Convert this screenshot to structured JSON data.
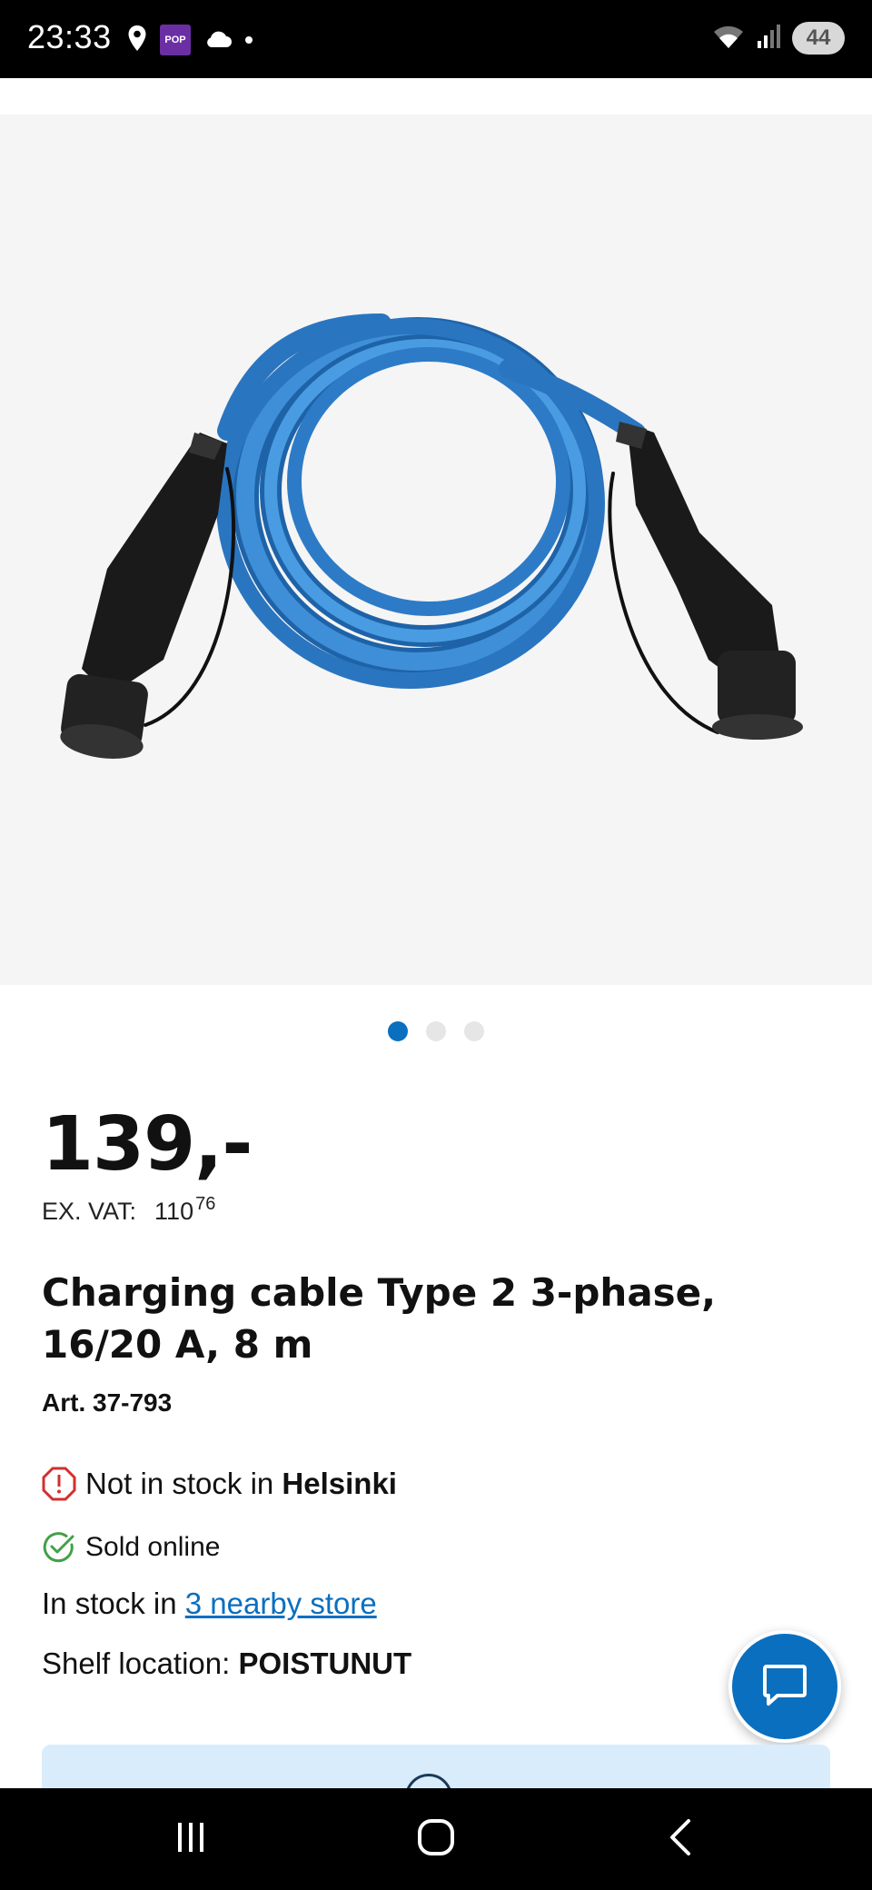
{
  "status_bar": {
    "time": "23:33",
    "notification_badge": "POP",
    "battery": "44"
  },
  "carousel": {
    "count": 3,
    "active_index": 0
  },
  "product": {
    "price": "139,-",
    "ex_vat_label": "EX. VAT:",
    "ex_vat_whole": "110",
    "ex_vat_cents": "76",
    "title": "Charging cable Type 2 3-phase, 16/20 A, 8 m",
    "article": "Art. 37-793"
  },
  "stock": {
    "not_in_stock_prefix": "Not in stock in",
    "not_in_stock_store": "Helsinki",
    "sold_online": "Sold online",
    "in_stock_prefix": "In stock in",
    "nearby_link": "3 nearby store",
    "shelf_label": "Shelf location:",
    "shelf_value": "POISTUNUT"
  },
  "colors": {
    "accent": "#0a6fbf",
    "warning": "#d32f2f",
    "success": "#43a047",
    "card_bg": "#d9ecfb"
  },
  "icons": [
    "location-pin-icon",
    "cloud-icon",
    "wifi-icon",
    "signal-icon",
    "alert-octagon-icon",
    "check-circle-icon",
    "chat-bubble-icon",
    "recent-apps-icon",
    "home-icon",
    "back-icon"
  ]
}
